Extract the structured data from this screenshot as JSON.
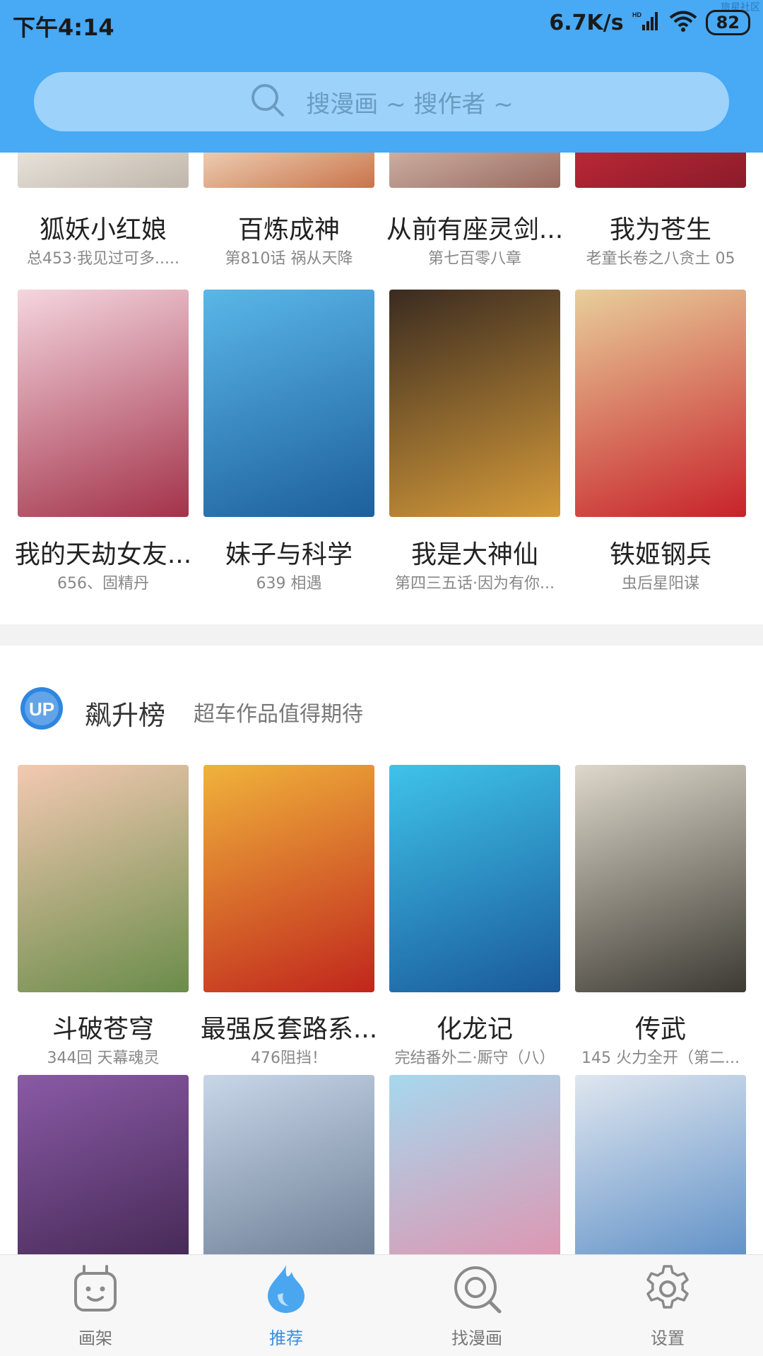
{
  "status": {
    "time": "下午4:14",
    "net_speed": "6.7K/s",
    "battery": "82",
    "watermark": "旅星社区"
  },
  "search": {
    "placeholder": "搜漫画 ~ 搜作者 ~"
  },
  "row1": [
    {
      "title": "狐妖小红娘",
      "sub": "总453·我见过可多.....",
      "colors": [
        "#f1eee8",
        "#c0b6aa"
      ]
    },
    {
      "title": "百炼成神",
      "sub": "第810话 祸从天降",
      "colors": [
        "#f6e5cf",
        "#c9744a"
      ]
    },
    {
      "title": "从前有座灵剑...",
      "sub": "第七百零八章",
      "colors": [
        "#d9c0b4",
        "#9a6b60"
      ]
    },
    {
      "title": "我为苍生",
      "sub": "老童长卷之八贪土 05",
      "colors": [
        "#c92b3a",
        "#8a1b2a"
      ]
    }
  ],
  "row2": [
    {
      "title": "我的天劫女友...",
      "sub": "656、固精丹",
      "colors": [
        "#f4d6df",
        "#a3324a"
      ]
    },
    {
      "title": "妹子与科学",
      "sub": "639  相遇",
      "colors": [
        "#5ab7e8",
        "#1d5f9c"
      ]
    },
    {
      "title": "我是大神仙",
      "sub": "第四三五话·因为有你...",
      "colors": [
        "#3a2b20",
        "#d49a3a"
      ]
    },
    {
      "title": "铁姬钢兵",
      "sub": "虫后星阳谋",
      "colors": [
        "#e8cf9b",
        "#c8222a"
      ]
    }
  ],
  "section": {
    "badge": "UP",
    "title": "飙升榜",
    "subtitle": "超车作品值得期待"
  },
  "row3": [
    {
      "title": "斗破苍穹",
      "sub": "344回 天幕魂灵",
      "colors": [
        "#f3c9b2",
        "#6a8c4a"
      ]
    },
    {
      "title": "最强反套路系...",
      "sub": "476阻挡！",
      "colors": [
        "#f0b33b",
        "#c0261c"
      ]
    },
    {
      "title": "化龙记",
      "sub": "完结番外二·厮守（八）",
      "colors": [
        "#3fc3ea",
        "#1a5a9a"
      ]
    },
    {
      "title": "传武",
      "sub": "145 火力全开（第二...",
      "colors": [
        "#ded8cb",
        "#3c3a33"
      ]
    }
  ],
  "row4": [
    {
      "colors": [
        "#8a5aa6",
        "#3a2148"
      ]
    },
    {
      "colors": [
        "#c8d6e8",
        "#5e7088"
      ]
    },
    {
      "colors": [
        "#a6d8ee",
        "#e88aa6"
      ]
    },
    {
      "colors": [
        "#dfe6ef",
        "#4a82c0"
      ]
    }
  ],
  "tabs": [
    {
      "label": "画架",
      "icon": "bookshelf-icon",
      "active": false
    },
    {
      "label": "推荐",
      "icon": "droplet-icon",
      "active": true
    },
    {
      "label": "找漫画",
      "icon": "search-icon",
      "active": false
    },
    {
      "label": "设置",
      "icon": "gear-icon",
      "active": false
    }
  ],
  "colors": {
    "header": "#48a9f4",
    "search_bg": "#9dd2fb",
    "accent": "#3a8fe0",
    "tab_inactive": "#777777"
  }
}
